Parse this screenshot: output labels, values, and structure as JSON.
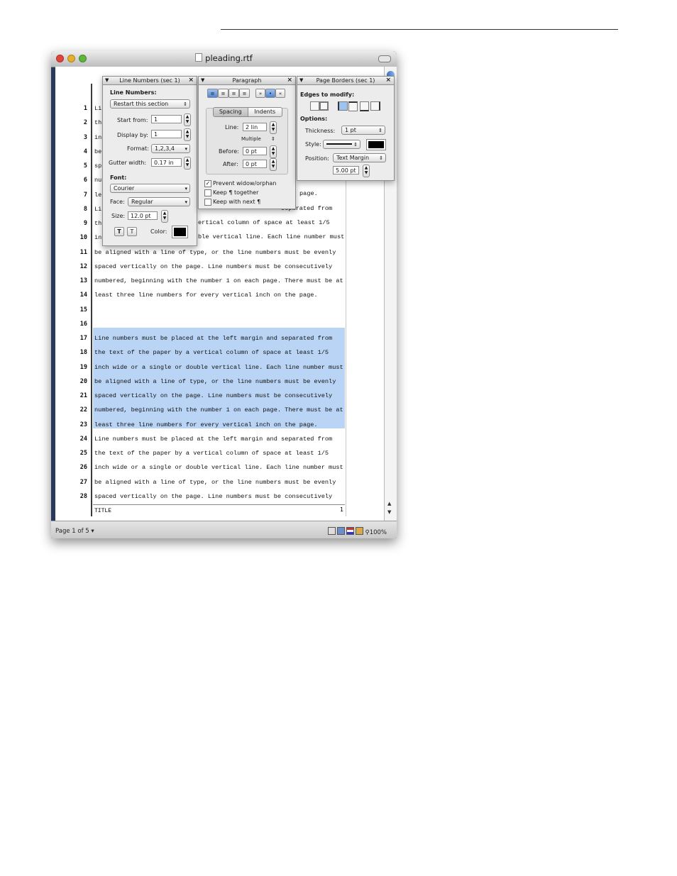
{
  "window": {
    "title": "pleading.rtf"
  },
  "document": {
    "line_numbers": [
      "1",
      "2",
      "3",
      "4",
      "5",
      "6",
      "7",
      "8",
      "9",
      "10",
      "11",
      "12",
      "13",
      "14",
      "15",
      "16",
      "17",
      "18",
      "19",
      "20",
      "21",
      "22",
      "23",
      "24",
      "25",
      "26",
      "27",
      "28"
    ],
    "visible_text": [
      {
        "n": 1,
        "text": "Li"
      },
      {
        "n": 2,
        "text": "th"
      },
      {
        "n": 3,
        "text": "in"
      },
      {
        "n": 4,
        "text": "be"
      },
      {
        "n": 5,
        "text": "sp"
      },
      {
        "n": 6,
        "text": "nu"
      },
      {
        "n": 7,
        "text": "le"
      },
      {
        "n": 8,
        "text": "Li"
      },
      {
        "n": 9,
        "text": "th"
      },
      {
        "n": 10,
        "text": "in"
      },
      {
        "n": 11,
        "text": "be aligned with a line of type, or the line numbers must be evenly"
      },
      {
        "n": 12,
        "text": "spaced vertically on the page. Line numbers must be consecutively"
      },
      {
        "n": 13,
        "text": "numbered, beginning with the number 1 on each page. There must be at"
      },
      {
        "n": 14,
        "text": "least three line numbers for every vertical inch on the page."
      },
      {
        "n": 15,
        "text": ""
      },
      {
        "n": 16,
        "text": ""
      },
      {
        "n": 17,
        "text": "Line numbers must be placed at the left margin and separated from"
      },
      {
        "n": 18,
        "text": "the text of the paper by a vertical column of space at least 1/5"
      },
      {
        "n": 19,
        "text": "inch wide or a single or double vertical line. Each line number must"
      },
      {
        "n": 20,
        "text": "be aligned with a line of type, or the line numbers must be evenly"
      },
      {
        "n": 21,
        "text": "spaced vertically on the page. Line numbers must be consecutively"
      },
      {
        "n": 22,
        "text": "numbered, beginning with the number 1 on each page. There must be at"
      },
      {
        "n": 23,
        "text": "least three line numbers for every vertical inch on the page."
      },
      {
        "n": 24,
        "text": "Line numbers must be placed at the left margin and separated from"
      },
      {
        "n": 25,
        "text": "the text of the paper by a vertical column of space at least 1/5"
      },
      {
        "n": 26,
        "text": "inch wide or a single or double vertical line. Each line number must"
      },
      {
        "n": 27,
        "text": "be aligned with a line of type, or the line numbers must be evenly"
      },
      {
        "n": 28,
        "text": "spaced vertically on the page. Line numbers must be consecutively"
      }
    ],
    "partial_right": {
      "l6": "e must be at",
      "l7": "page.",
      "l8": "separated from",
      "l9": "ertical column of space at least 1/5",
      "l10": "ble vertical line. Each line number must"
    },
    "footer_title": "TITLE",
    "footer_mark": "1"
  },
  "status": {
    "page": "Page 1 of 5",
    "zoom": "100%"
  },
  "line_numbers_palette": {
    "title": "Line Numbers (sec 1)",
    "heading": "Line Numbers:",
    "restart_option": "Restart this section",
    "start_from_label": "Start from:",
    "start_from_value": "1",
    "display_by_label": "Display by:",
    "display_by_value": "1",
    "format_label": "Format:",
    "format_value": "1,2,3,4",
    "gutter_label": "Gutter width:",
    "gutter_value": "0.17 in",
    "font_heading": "Font:",
    "font_value": "Courier",
    "face_label": "Face:",
    "face_value": "Regular",
    "size_label": "Size:",
    "size_value": "12.0 pt",
    "bold_btn": "T",
    "italic_btn": "T",
    "color_label": "Color:"
  },
  "paragraph_palette": {
    "title": "Paragraph",
    "tab_spacing": "Spacing",
    "tab_indents": "Indents",
    "line_label": "Line:",
    "line_value": "2 lin",
    "multiple_label": "Multiple",
    "before_label": "Before:",
    "before_value": "0 pt",
    "after_label": "After:",
    "after_value": "0 pt",
    "prevent_widow": "Prevent widow/orphan",
    "keep_together": "Keep ¶ together",
    "keep_with_next": "Keep with next ¶"
  },
  "borders_palette": {
    "title": "Page Borders (sec 1)",
    "edges_heading": "Edges to modify:",
    "options_heading": "Options:",
    "thickness_label": "Thickness:",
    "thickness_value": "1 pt",
    "style_label": "Style:",
    "position_label": "Position:",
    "position_value": "Text Margin",
    "offset_value": "5.00 pt"
  },
  "colors": {
    "selection": "#b9d4f5",
    "window_frame": "#2a3a5c"
  }
}
